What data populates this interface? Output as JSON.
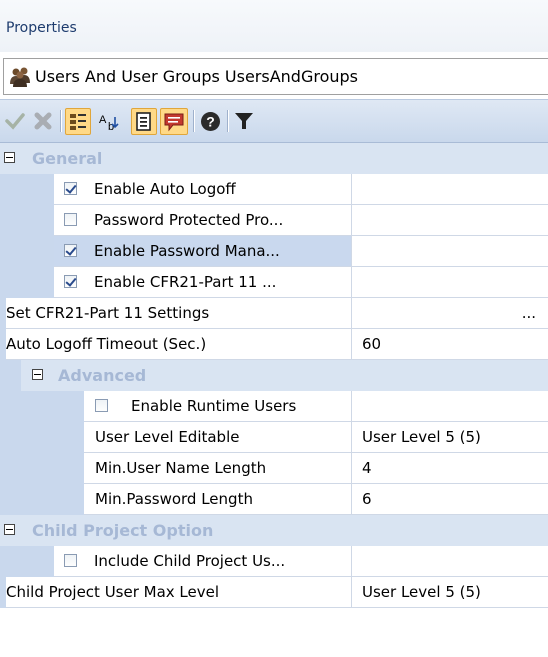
{
  "panel": {
    "title": "Properties"
  },
  "object_selector": {
    "text": "Users And User Groups UsersAndGroups",
    "icon": "users-group-icon"
  },
  "toolbar": {
    "buttons": [
      {
        "name": "apply-icon",
        "active": false
      },
      {
        "name": "cancel-icon",
        "active": false
      },
      {
        "name": "categorized-icon",
        "active": true
      },
      {
        "name": "alphabetical-icon",
        "active": false
      },
      {
        "name": "property-pages-icon",
        "active": true
      },
      {
        "name": "events-icon",
        "active": true
      },
      {
        "name": "help-icon",
        "active": false
      },
      {
        "name": "filter-icon",
        "active": false
      }
    ]
  },
  "categories": {
    "general": "General",
    "advanced": "Advanced",
    "child_project": "Child Project Option"
  },
  "properties": {
    "enable_auto_logoff": {
      "label": "Enable Auto Logoff",
      "checked": true,
      "value": ""
    },
    "password_protected": {
      "label": "Password Protected Pro...",
      "checked": false,
      "value": ""
    },
    "enable_password_mgmt": {
      "label": "Enable Password Mana...",
      "checked": true,
      "value": ""
    },
    "enable_cfr21": {
      "label": "Enable CFR21-Part 11 ...",
      "checked": true,
      "value": ""
    },
    "set_cfr21": {
      "label": "Set CFR21-Part 11 Settings",
      "value": "..."
    },
    "auto_logoff_timeout": {
      "label": "Auto Logoff Timeout (Sec.)",
      "value": "60"
    },
    "enable_runtime_users": {
      "label": "Enable Runtime Users",
      "checked": false,
      "value": ""
    },
    "user_level_editable": {
      "label": "User Level Editable",
      "value": "User Level 5 (5)"
    },
    "min_user_name_length": {
      "label": "Min.User Name Length",
      "value": "4"
    },
    "min_password_length": {
      "label": "Min.Password Length",
      "value": "6"
    },
    "include_child_project": {
      "label": "Include Child Project Us...",
      "checked": false,
      "value": ""
    },
    "child_project_max_level": {
      "label": "Child Project User Max Level",
      "value": "User Level 5 (5)"
    }
  }
}
